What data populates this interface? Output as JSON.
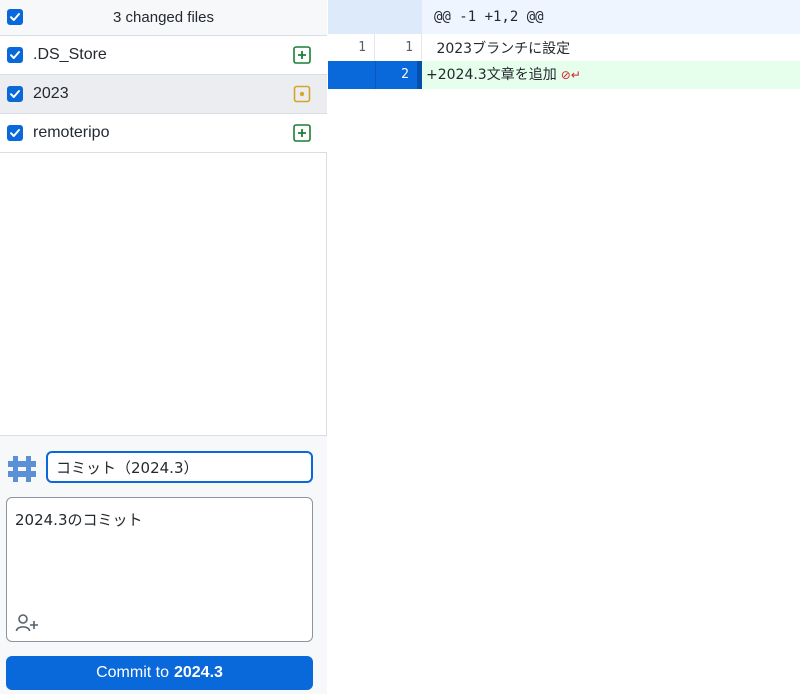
{
  "changes": {
    "count_label": "3 changed files",
    "files": [
      {
        "name": ".DS_Store",
        "status": "added"
      },
      {
        "name": "2023",
        "status": "modified"
      },
      {
        "name": "remoteripo",
        "status": "added"
      }
    ]
  },
  "commit": {
    "summary": "コミット（2024.3）",
    "description": "2024.3のコミット",
    "button_prefix": "Commit to",
    "button_branch": "2024.3"
  },
  "diff": {
    "hunk_header": "@@ -1 +1,2 @@",
    "lines": [
      {
        "old": "1",
        "new": "1",
        "text": " 2023ブランチに設定"
      },
      {
        "old": "",
        "new": "2",
        "text": "+2024.3文章を追加"
      }
    ],
    "no_newline_marker": "⊘↵"
  },
  "colors": {
    "accent": "#0969da",
    "added": "#1a7f37",
    "modified": "#d4a72c",
    "addition_bg": "#e6ffec"
  }
}
